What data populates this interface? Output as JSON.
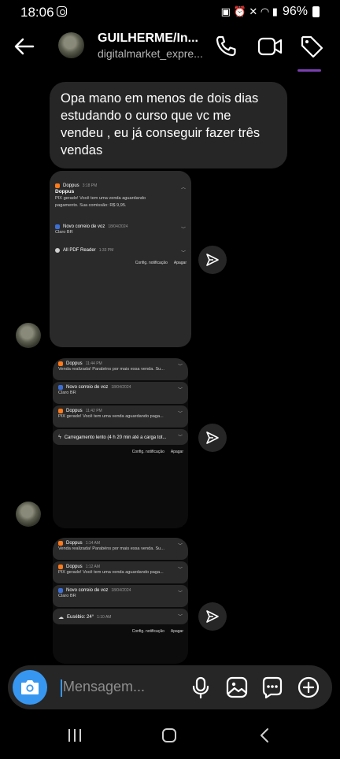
{
  "status_bar": {
    "time": "18:06",
    "battery": "96%"
  },
  "header": {
    "name": "GUILHERME/In...",
    "username": "digitalmarket_expre..."
  },
  "chat": {
    "message_text": "Opa mano em menos de dois dias estudando o curso que vc me vendeu , eu já conseguir fazer três vendas"
  },
  "screenshot_1": {
    "notifications": [
      {
        "app": "Doppus",
        "time": "3:18 PM",
        "title": "Doppus",
        "body": "PIX gerado! Você tem uma venda aguardando pagamento. Sua comissão: R$ 9,95."
      },
      {
        "app": "Novo correio de voz",
        "time": "18/04/2024",
        "body": "Claro BR"
      },
      {
        "app": "All PDF Reader",
        "time": "1:33 PM",
        "body": ""
      }
    ],
    "actions": [
      "Config. notificação",
      "Apagar"
    ]
  },
  "screenshot_2": {
    "notifications": [
      {
        "app": "Doppus",
        "time": "11:44 PM",
        "body": "Venda realizada! Parabéns por mais essa venda. Su..."
      },
      {
        "app": "Novo correio de voz",
        "time": "18/04/2024",
        "body": "Claro BR"
      },
      {
        "app": "Doppus",
        "time": "11:42 PM",
        "body": "PIX gerado! Você tem uma venda aguardando paga..."
      },
      {
        "app": "Carregamento lento (4 h 20 min até a carga tot...",
        "time": "",
        "body": ""
      }
    ],
    "actions": [
      "Config. notificação",
      "Apagar"
    ]
  },
  "screenshot_3": {
    "notifications": [
      {
        "app": "Doppus",
        "time": "1:14 AM",
        "body": "Venda realizada! Parabéns por mais essa venda. Su..."
      },
      {
        "app": "Doppus",
        "time": "1:12 AM",
        "body": "PIX gerado! Você tem uma venda aguardando paga..."
      },
      {
        "app": "Novo correio de voz",
        "time": "18/04/2024",
        "body": "Claro BR"
      },
      {
        "app": "Eusébio: 24°",
        "time": "1:10 AM",
        "body": ""
      }
    ],
    "actions": [
      "Config. notificação",
      "Apagar"
    ]
  },
  "composer": {
    "placeholder": "Mensagem..."
  },
  "colors": {
    "accent": "#3797f0",
    "bubble": "#262626",
    "background": "#000000"
  },
  "icons": [
    "back-arrow-icon",
    "phone-icon",
    "video-icon",
    "tag-icon",
    "send-icon",
    "camera-icon",
    "microphone-icon",
    "gallery-icon",
    "sticker-icon",
    "plus-icon",
    "recent-apps-icon",
    "home-icon",
    "nav-back-icon"
  ]
}
